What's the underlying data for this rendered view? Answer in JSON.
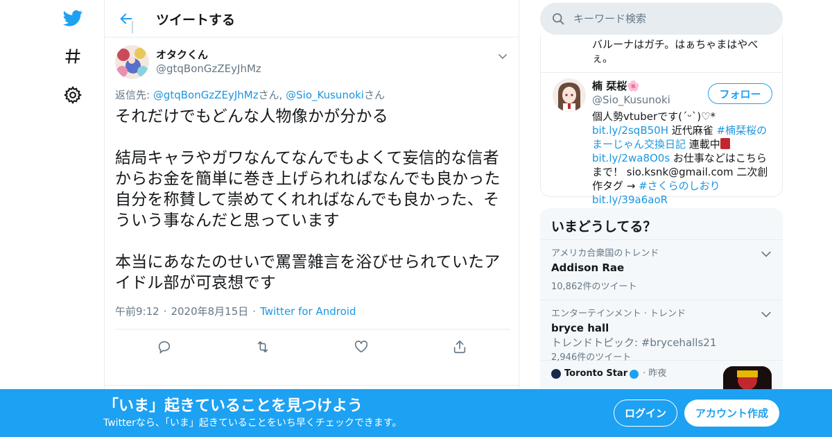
{
  "nav": {
    "items": [
      {
        "icon": "twitter-bird-icon"
      },
      {
        "icon": "hashtag-icon"
      },
      {
        "icon": "gear-icon"
      }
    ]
  },
  "header": {
    "title": "ツイートする"
  },
  "tweet": {
    "author_name": "オタクくん",
    "author_handle": "@gtqBonGzZEyJhMz",
    "reply_prefix": "返信先: ",
    "reply_user1": "@gtqBonGzZEyJhMz",
    "reply_suffix1": "さん, ",
    "reply_user2": "@Sio_Kusunoki",
    "reply_suffix2": "さん",
    "text": "それだけでもどんな人物像かが分かる\n\n結局キャラやガワなんてなんでもよくて妄信的な信者からお金を簡単に巻き上げられればなんでも良かった\n自分を称賛して崇めてくれればなんでも良かった、そういう事なんだと思っています\n\n本当にあなたのせいで罵詈雑言を浴びせられていたアイドル部が可哀想です",
    "time": "午前9:12",
    "sep": "·",
    "date": "2020年8月15日",
    "source": "Twitter for Android"
  },
  "search": {
    "placeholder": "キーワード検索"
  },
  "profile_card": {
    "prev_text": "バルーナはガチ。はぁちゃまはやべぇ。",
    "name": "楠 栞桜🌸",
    "handle": "@Sio_Kusunoki",
    "follow_label": "フォロー",
    "bio_1": "個人勢vtuberです(ˊᵕˋ)♡*",
    "bio_link1": "bit.ly/2sqB50H",
    "bio_2": " 近代麻雀 ",
    "bio_tag1": "#楠栞桜のまーじゃん交換日記",
    "bio_3": " 連載中",
    "bio_link2": "bit.ly/2wa8O0s",
    "bio_4": " お仕事などはこちらまで！ sio.ksnk@gmail.com 二次創作タグ → ",
    "bio_tag2": "#さくらのしおり",
    "bio_link3": "bit.ly/39a6aoR"
  },
  "trends": {
    "title": "いまどうしてる？",
    "items": [
      {
        "category": "アメリカ合衆国のトレンド",
        "name": "Addison Rae",
        "sub": "",
        "count": "10,862件のツイート"
      },
      {
        "category": "エンターテインメント · トレンド",
        "name": "bryce hall",
        "sub": "トレンドトピック: #brycehalls21",
        "count": "2,946件のツイート"
      }
    ],
    "news": {
      "source": "Toronto Star",
      "time": "· 昨夜"
    }
  },
  "banner": {
    "title": "「いま」起きていることを見つけよう",
    "subtitle": "Twitterなら、「いま」起きていることをいち早くチェックできます。",
    "login_label": "ログイン",
    "signup_label": "アカウント作成"
  },
  "colors": {
    "accent": "#1da1f2",
    "link": "#1b95e0",
    "muted": "#657786"
  }
}
